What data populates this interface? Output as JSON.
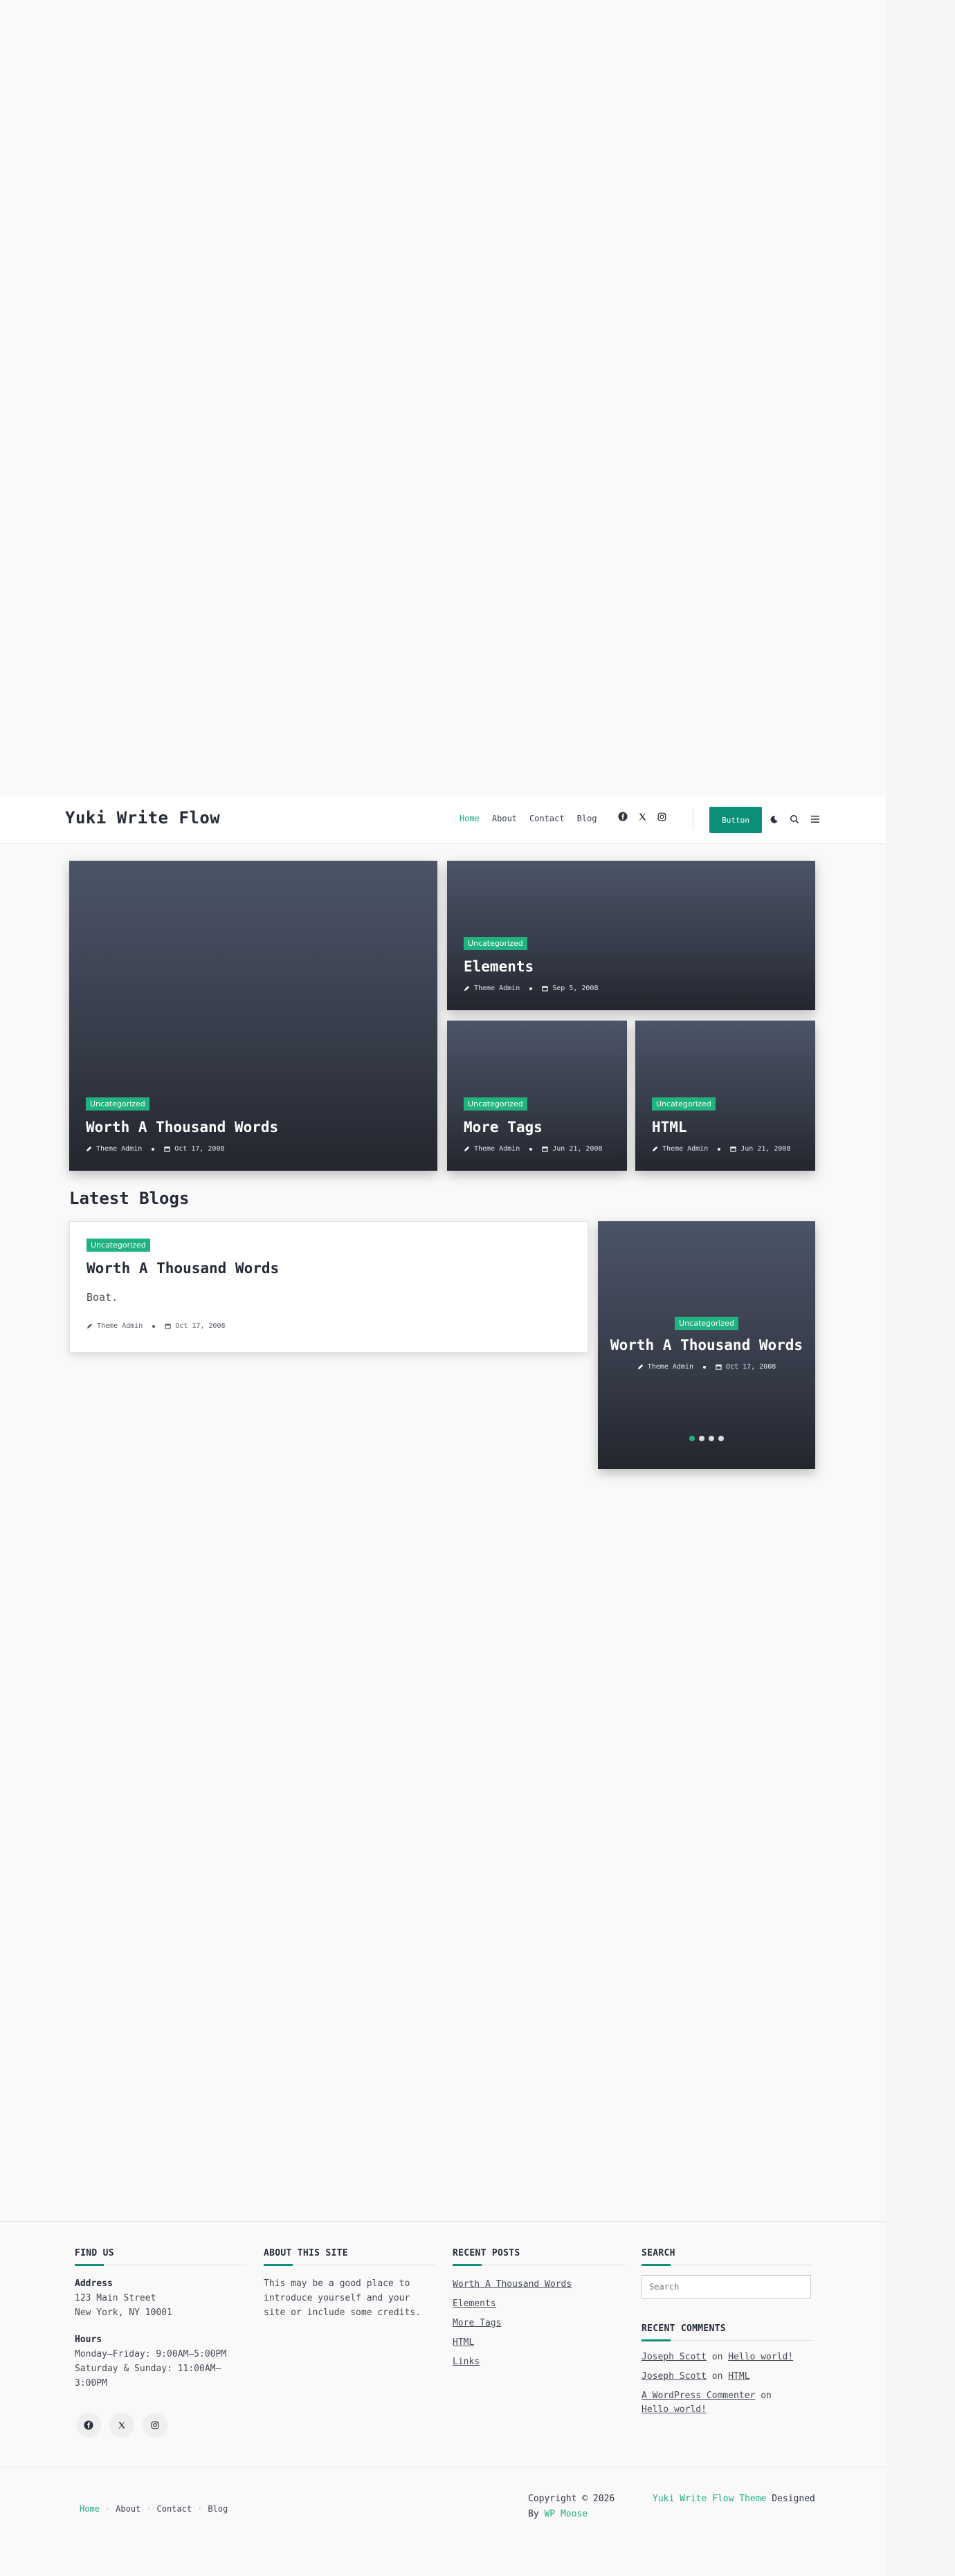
{
  "header": {
    "site_title": "Yuki Write Flow",
    "nav": [
      "Home",
      "About",
      "Contact",
      "Blog"
    ],
    "button_label": "Button"
  },
  "featured": [
    {
      "category": "Uncategorized",
      "title": "Worth A Thousand Words",
      "author": "Theme Admin",
      "date": "Oct 17, 2008"
    },
    {
      "category": "Uncategorized",
      "title": "Elements",
      "author": "Theme Admin",
      "date": "Sep 5, 2008"
    },
    {
      "category": "Uncategorized",
      "title": "More Tags",
      "author": "Theme Admin",
      "date": "Jun 21, 2008"
    },
    {
      "category": "Uncategorized",
      "title": "HTML",
      "author": "Theme Admin",
      "date": "Jun 21, 2008"
    }
  ],
  "latest": {
    "heading": "Latest Blogs",
    "post": {
      "category": "Uncategorized",
      "title": "Worth A Thousand Words",
      "excerpt": "Boat.",
      "author": "Theme Admin",
      "date": "Oct 17, 2008"
    },
    "slider": {
      "category": "Uncategorized",
      "title": "Worth A Thousand Words",
      "author": "Theme Admin",
      "date": "Oct 17, 2008",
      "active_slide": 1,
      "slide_count": 4
    }
  },
  "footer": {
    "find_us": {
      "heading": "FIND US",
      "address_label": "Address",
      "address_line1": "123 Main Street",
      "address_line2": "New York, NY 10001",
      "hours_label": "Hours",
      "hours_line1": "Monday–Friday: 9:00AM–5:00PM",
      "hours_line2": "Saturday & Sunday: 11:00AM–3:00PM"
    },
    "about": {
      "heading": "ABOUT THIS SITE",
      "text": "This may be a good place to introduce yourself and your site or include some credits."
    },
    "recent_posts": {
      "heading": "RECENT POSTS",
      "items": [
        "Worth A Thousand Words",
        "Elements",
        "More Tags",
        "HTML",
        "Links"
      ]
    },
    "search": {
      "heading": "SEARCH",
      "placeholder": "Search"
    },
    "recent_comments": {
      "heading": "RECENT COMMENTS",
      "items": [
        {
          "author": "Joseph Scott",
          "on": "on",
          "post": "Hello world!"
        },
        {
          "author": "Joseph Scott",
          "on": "on",
          "post": "HTML"
        },
        {
          "author": "A WordPress Commenter",
          "on": "on",
          "post": "Hello world!"
        }
      ]
    },
    "nav": [
      "Home",
      "About",
      "Contact",
      "Blog"
    ],
    "copyright": "Copyright © 2026",
    "theme_link": "Yuki Write Flow Theme",
    "designed": "Designed",
    "by": "By",
    "author_link": "WP Moose"
  },
  "colors": {
    "accent": "#1fae85",
    "button": "#0e8f7a",
    "badge": "#20b27f"
  }
}
